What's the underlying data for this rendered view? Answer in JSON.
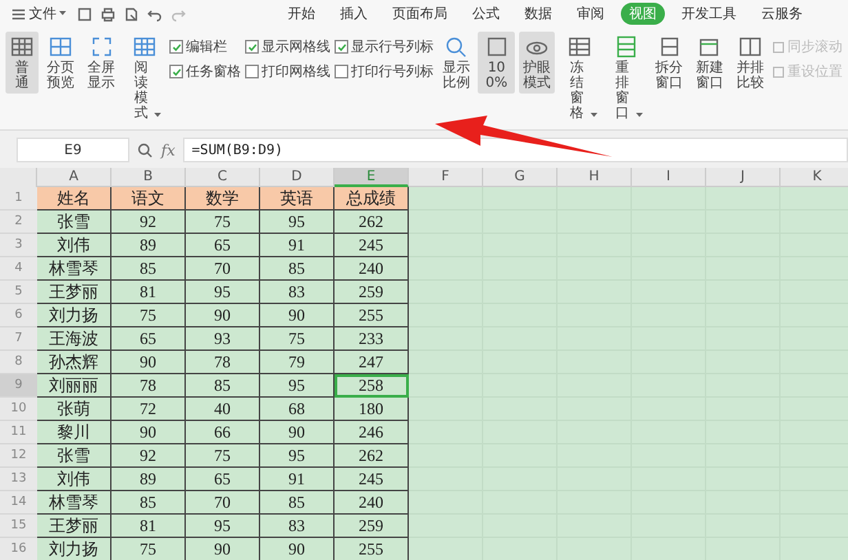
{
  "menu": {
    "label": "文件"
  },
  "tabs": [
    {
      "label": "开始",
      "selected": false
    },
    {
      "label": "插入",
      "selected": false
    },
    {
      "label": "页面布局",
      "selected": false
    },
    {
      "label": "公式",
      "selected": false
    },
    {
      "label": "数据",
      "selected": false
    },
    {
      "label": "审阅",
      "selected": false
    },
    {
      "label": "视图",
      "selected": true
    },
    {
      "label": "开发工具",
      "selected": false
    },
    {
      "label": "云服务",
      "selected": false
    }
  ],
  "toolbar": [
    {
      "kind": "button",
      "label": "普通",
      "selected": true,
      "dropdown": false
    },
    {
      "kind": "button",
      "label": "分页预览",
      "selected": false,
      "dropdown": false
    },
    {
      "kind": "button",
      "label": "全屏显示",
      "selected": false,
      "dropdown": false
    },
    {
      "kind": "button",
      "label": "阅读模式",
      "selected": false,
      "dropdown": true
    },
    {
      "kind": "checks",
      "items": [
        {
          "label": "编辑栏",
          "checked": true
        },
        {
          "label": "任务窗格",
          "checked": true
        }
      ]
    },
    {
      "kind": "checks",
      "items": [
        {
          "label": "显示网格线",
          "checked": true
        },
        {
          "label": "打印网格线",
          "checked": false
        }
      ]
    },
    {
      "kind": "checks",
      "items": [
        {
          "label": "显示行号列标",
          "checked": true
        },
        {
          "label": "打印行号列标",
          "checked": false
        }
      ]
    },
    {
      "kind": "button",
      "label": "显示比例",
      "selected": false,
      "dropdown": false
    },
    {
      "kind": "button",
      "label": "100%",
      "selected": true,
      "dropdown": false
    },
    {
      "kind": "button",
      "label": "护眼模式",
      "selected": true,
      "dropdown": false
    },
    {
      "kind": "button",
      "label": "冻结窗格",
      "selected": false,
      "dropdown": true
    },
    {
      "kind": "button",
      "label": "重排窗口",
      "selected": false,
      "dropdown": true
    },
    {
      "kind": "button",
      "label": "拆分窗口",
      "selected": false,
      "dropdown": false
    },
    {
      "kind": "button",
      "label": "新建窗口",
      "selected": false,
      "dropdown": false
    },
    {
      "kind": "button",
      "label": "并排比较",
      "selected": false,
      "dropdown": false
    },
    {
      "kind": "small",
      "items": [
        {
          "label": "同步滚动",
          "disabled": true
        },
        {
          "label": "重设位置",
          "disabled": true
        }
      ]
    }
  ],
  "formula_bar": {
    "name_box": "E9",
    "fx": "fx",
    "formula": "=SUM(B9:D9)"
  },
  "columns": [
    {
      "label": "A",
      "selected": false
    },
    {
      "label": "B",
      "selected": false
    },
    {
      "label": "C",
      "selected": false
    },
    {
      "label": "D",
      "selected": false
    },
    {
      "label": "E",
      "selected": true
    },
    {
      "label": "F",
      "selected": false
    },
    {
      "label": "G",
      "selected": false
    },
    {
      "label": "H",
      "selected": false
    },
    {
      "label": "I",
      "selected": false
    },
    {
      "label": "J",
      "selected": false
    },
    {
      "label": "K",
      "selected": false
    }
  ],
  "rows": [
    {
      "number": "1",
      "kind": "header",
      "selected": false,
      "cells": [
        "姓名",
        "语文",
        "数学",
        "英语",
        "总成绩"
      ]
    },
    {
      "number": "2",
      "kind": "data",
      "selected": false,
      "cells": [
        "张雪",
        "92",
        "75",
        "95",
        "262"
      ]
    },
    {
      "number": "3",
      "kind": "data",
      "selected": false,
      "cells": [
        "刘伟",
        "89",
        "65",
        "91",
        "245"
      ]
    },
    {
      "number": "4",
      "kind": "data",
      "selected": false,
      "cells": [
        "林雪琴",
        "85",
        "70",
        "85",
        "240"
      ]
    },
    {
      "number": "5",
      "kind": "data",
      "selected": false,
      "cells": [
        "王梦丽",
        "81",
        "95",
        "83",
        "259"
      ]
    },
    {
      "number": "6",
      "kind": "data",
      "selected": false,
      "cells": [
        "刘力扬",
        "75",
        "90",
        "90",
        "255"
      ]
    },
    {
      "number": "7",
      "kind": "data",
      "selected": false,
      "cells": [
        "王海波",
        "65",
        "93",
        "75",
        "233"
      ]
    },
    {
      "number": "8",
      "kind": "data",
      "selected": false,
      "cells": [
        "孙杰辉",
        "90",
        "78",
        "79",
        "247"
      ]
    },
    {
      "number": "9",
      "kind": "data",
      "selected": true,
      "cells": [
        "刘丽丽",
        "78",
        "85",
        "95",
        "258"
      ]
    },
    {
      "number": "10",
      "kind": "data",
      "selected": false,
      "cells": [
        "张萌",
        "72",
        "40",
        "68",
        "180"
      ]
    },
    {
      "number": "11",
      "kind": "data",
      "selected": false,
      "cells": [
        "黎川",
        "90",
        "66",
        "90",
        "246"
      ]
    },
    {
      "number": "12",
      "kind": "data",
      "selected": false,
      "cells": [
        "张雪",
        "92",
        "75",
        "95",
        "262"
      ]
    },
    {
      "number": "13",
      "kind": "data",
      "selected": false,
      "cells": [
        "刘伟",
        "89",
        "65",
        "91",
        "245"
      ]
    },
    {
      "number": "14",
      "kind": "data",
      "selected": false,
      "cells": [
        "林雪琴",
        "85",
        "70",
        "85",
        "240"
      ]
    },
    {
      "number": "15",
      "kind": "data",
      "selected": false,
      "cells": [
        "王梦丽",
        "81",
        "95",
        "83",
        "259"
      ]
    },
    {
      "number": "16",
      "kind": "data",
      "selected": false,
      "cells": [
        "刘力扬",
        "75",
        "90",
        "90",
        "255"
      ]
    }
  ]
}
